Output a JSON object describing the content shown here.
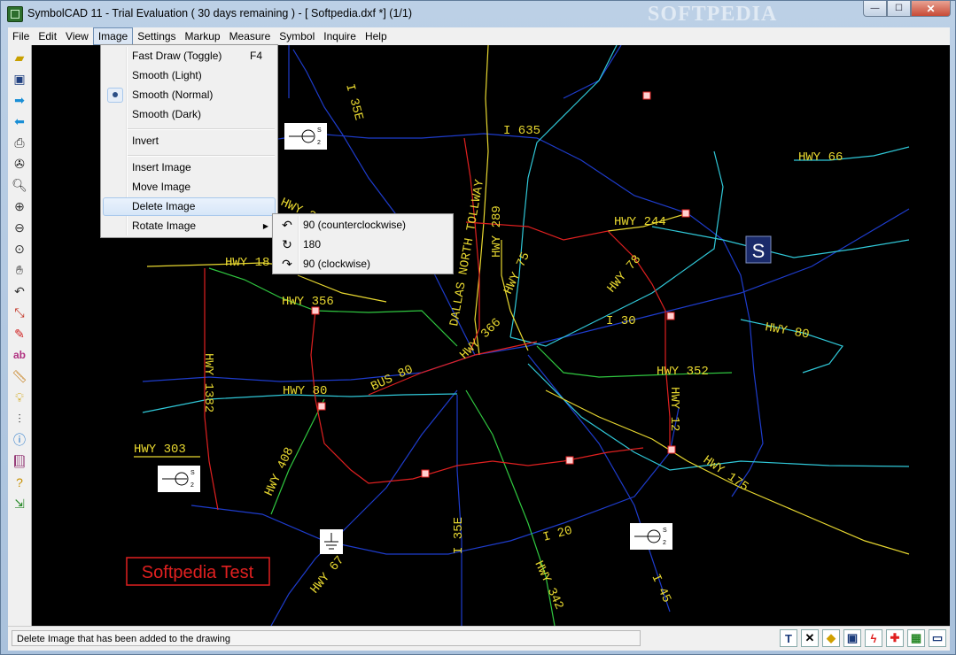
{
  "window": {
    "title": "SymbolCAD 11 - Trial Evaluation ( 30 days remaining )  -  [ Softpedia.dxf *] (1/1)",
    "watermark": "SOFTPEDIA",
    "buttons": {
      "minimize": "—",
      "maximize": "☐",
      "close": "✕"
    }
  },
  "menubar": [
    "File",
    "Edit",
    "View",
    "Image",
    "Settings",
    "Markup",
    "Measure",
    "Symbol",
    "Inquire",
    "Help"
  ],
  "image_menu": {
    "fast_draw": "Fast Draw (Toggle)",
    "fast_draw_key": "F4",
    "smooth_light": "Smooth (Light)",
    "smooth_normal": "Smooth (Normal)",
    "smooth_dark": "Smooth (Dark)",
    "invert": "Invert",
    "insert": "Insert Image",
    "move": "Move Image",
    "delete": "Delete Image",
    "rotate": "Rotate Image"
  },
  "rotate_submenu": {
    "ccw": "90 (counterclockwise)",
    "r180": "180",
    "cw": "90 (clockwise)"
  },
  "canvas": {
    "textbox": "Softpedia Test",
    "s_label": "S",
    "road_labels": {
      "i35e_top": "I 35E",
      "i635": "I 635",
      "hwy66": "HWY 66",
      "dnt": "DALLAS NORTH TOLLWAY",
      "hwy289": "HWY 289",
      "hwy244": "HWY 244",
      "hwy34x": "HWY 34",
      "hwy18x": "HWY 18",
      "hwy75": "HWY 75",
      "hwy78": "HWY 78",
      "hwy356": "HWY 356",
      "hwy366": "HWY 366",
      "i30": "I 30",
      "hwy80r": "HWY 80",
      "bus80": "BUS 80",
      "hwy352": "HWY 352",
      "hwy80l": "HWY 80",
      "hwy1382": "HWY 1382",
      "hwy12": "HWY 12",
      "hwy303": "HWY 303",
      "hwy408": "HWY 408",
      "hwy175": "HWY 175",
      "i35e_bot": "I 35E",
      "i20": "I 20",
      "hwy67": "HWY 67",
      "hwy342": "HWY 342",
      "i45": "I 45"
    }
  },
  "statusbar": {
    "message": "Delete Image that has been added to the drawing"
  }
}
